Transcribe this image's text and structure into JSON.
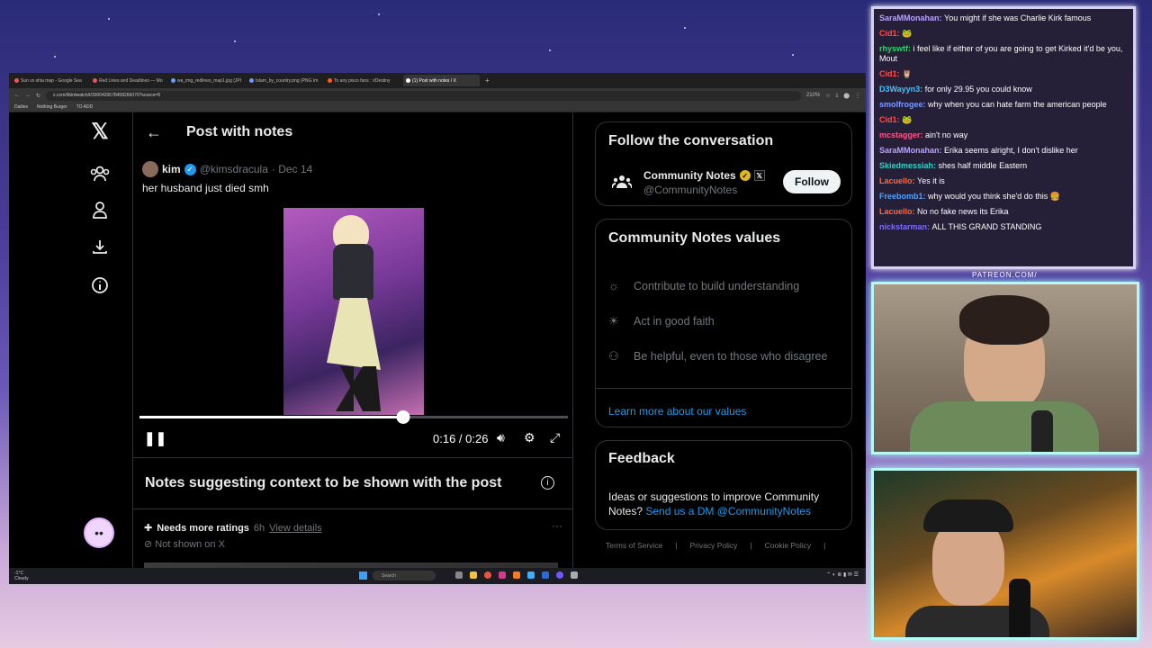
{
  "browser": {
    "tabs": [
      {
        "label": "Sun vs shia map - Google Sea"
      },
      {
        "label": "Red Lines and Deadlines — Mo"
      },
      {
        "label": "wa_img_redlines_map1.jpg (JPI"
      },
      {
        "label": "Islam_by_country.png (PNG Im"
      },
      {
        "label": "To any pisco fans : r/Destiny"
      },
      {
        "label": "(1) Post with notes / X"
      }
    ],
    "new_tab": "+",
    "url": "x.com/i/birdwatch/t/2000420678458266070?source=5",
    "zoom": "210%",
    "bookmarks": [
      "Dailies",
      "Nothing Burger",
      "TO ADD"
    ]
  },
  "nav": {
    "icons": [
      "x-logo-icon",
      "communities-icon",
      "profile-icon",
      "download-icon",
      "info-icon"
    ]
  },
  "header": {
    "back": "←",
    "title": "Post with notes"
  },
  "post": {
    "name": "kim",
    "handle": "@kimsdracula",
    "date": "· Dec 14",
    "text": "her husband just died smh"
  },
  "video": {
    "time": "0:16 / 0:26",
    "progress_fraction": 0.615,
    "pause_glyph": "❚❚"
  },
  "notes": {
    "title": "Notes suggesting context to be shown with the post",
    "status": "Needs more ratings",
    "age": "6h",
    "view_details": "View details",
    "not_shown": "Not shown on X",
    "more": "···"
  },
  "follow_card": {
    "title": "Follow the conversation",
    "name": "Community Notes",
    "handle": "@CommunityNotes",
    "follow": "Follow"
  },
  "values_card": {
    "title": "Community Notes values",
    "items": [
      {
        "icon": "sun-icon",
        "glyph": "☼",
        "text": "Contribute to build understanding"
      },
      {
        "icon": "sparkle-sun-icon",
        "glyph": "☀",
        "text": "Act in good faith"
      },
      {
        "icon": "people-icon",
        "glyph": "⚇",
        "text": "Be helpful, even to those who disagree"
      }
    ],
    "learn_more": "Learn more about our values"
  },
  "feedback_card": {
    "title": "Feedback",
    "text": "Ideas or suggestions to improve Community Notes?",
    "link": "Send us a DM @CommunityNotes"
  },
  "footer": [
    "Terms of Service",
    "Privacy Policy",
    "Cookie Policy"
  ],
  "taskbar": {
    "weather": "-1°C",
    "weather_desc": "Cloudy",
    "search": "Search"
  },
  "chat": [
    {
      "user": "SaraMMonahan:",
      "text": "You might if she was Charlie Kirk famous",
      "color": "#b8a2ff"
    },
    {
      "user": "Cid1:",
      "text": "🐸",
      "color": "#ff4d4d"
    },
    {
      "user": "rhyswtf:",
      "text": "i feel like if either of you are going to get Kirked it'd be you, Mout",
      "color": "#2fd46a"
    },
    {
      "user": "Cid1:",
      "text": "🦉",
      "color": "#ff4d4d"
    },
    {
      "user": "D3Wayyn3:",
      "text": "for only 29.95 you could know",
      "color": "#44c2ff"
    },
    {
      "user": "smolfrogee:",
      "text": "why when you can hate farm the american people",
      "color": "#7a9bff"
    },
    {
      "user": "Cid1:",
      "text": "🐸",
      "color": "#ff4d4d"
    },
    {
      "user": "mcstagger:",
      "text": "ain't no way",
      "color": "#ff5588"
    },
    {
      "user": "SaraMMonahan:",
      "text": "Erika seems alright, I don't dislike her",
      "color": "#b8a2ff"
    },
    {
      "user": "Skiedmessiah:",
      "text": "shes half middle Eastern",
      "color": "#2fd4c8"
    },
    {
      "user": "Lacuello:",
      "text": "Yes it is",
      "color": "#ff6a3a"
    },
    {
      "user": "Freebomb1:",
      "text": "why would you think she'd do this 🍔",
      "color": "#4fa3ff"
    },
    {
      "user": "Lacuello:",
      "text": "No no fake news its Erika",
      "color": "#ff6a3a"
    },
    {
      "user": "nickstarman:",
      "text": "ALL THIS GRAND STANDING",
      "color": "#7a6bff"
    }
  ],
  "overlay": {
    "patreon": "PATREON.COM/"
  },
  "colors": {
    "accent": "#1d9bf0",
    "background": "#000000",
    "muted": "#71767b"
  }
}
